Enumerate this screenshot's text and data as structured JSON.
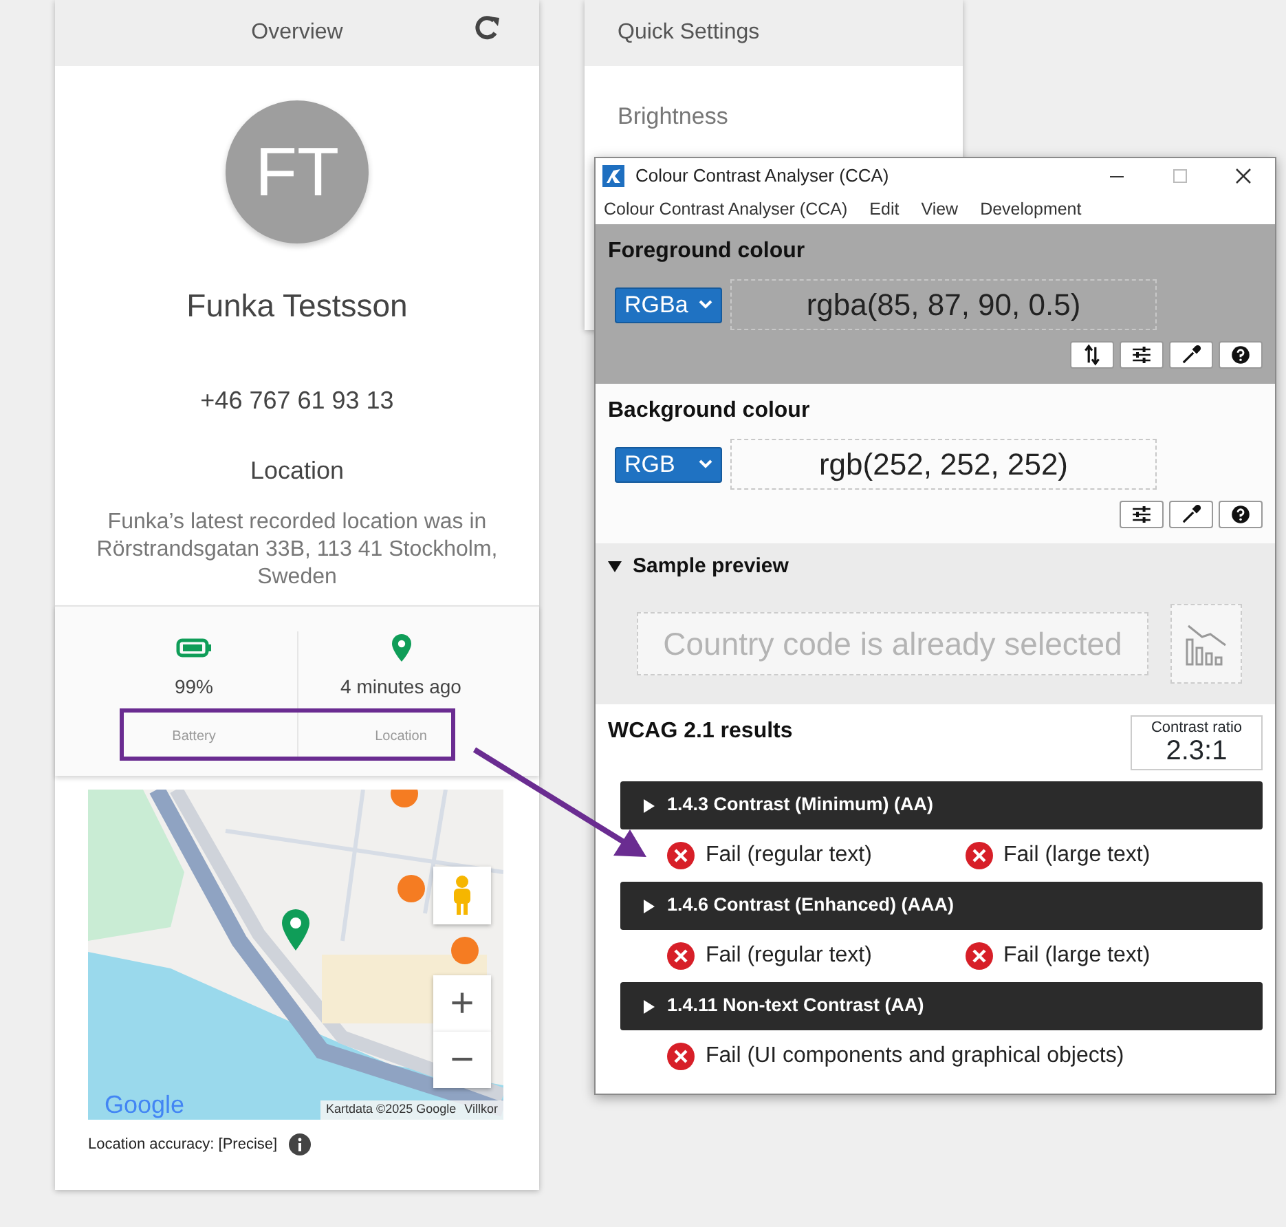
{
  "overview": {
    "title": "Overview",
    "initials": "FT",
    "name": "Funka Testsson",
    "phone": "+46 767 61 93 13",
    "location_heading": "Location",
    "location_text": "Funka’s latest recorded location was in Rörstrandsgatan 33B, 113 41 Stockholm, Sweden",
    "stats": [
      {
        "kind": "battery",
        "value": "99%",
        "label": "Battery"
      },
      {
        "kind": "location",
        "value": "4 minutes ago",
        "label": "Location"
      }
    ],
    "map": {
      "zoom_in": "+",
      "zoom_out": "−",
      "logo": "Google",
      "attribution": "Kartdata ©2025 Google",
      "terms": "Villkor"
    },
    "accuracy": "Location accuracy: [Precise]"
  },
  "quick_settings": {
    "title": "Quick Settings",
    "brightness": "Brightness"
  },
  "cca": {
    "title": "Colour Contrast Analyser (CCA)",
    "menu": [
      "Colour Contrast Analyser (CCA)",
      "Edit",
      "View",
      "Development"
    ],
    "colours": [
      {
        "kind": "foreground",
        "heading": "Foreground colour",
        "format": "RGBa",
        "value": "rgba(85, 87, 90, 0.5)"
      },
      {
        "kind": "background",
        "heading": "Background colour",
        "format": "RGB",
        "value": "rgb(252, 252, 252)"
      }
    ],
    "sample": {
      "heading": "Sample preview",
      "expanded": true,
      "text": "Country code is already selected"
    },
    "results": {
      "heading": "WCAG 2.1 results",
      "ratio_label": "Contrast ratio",
      "ratio": "2.3:1",
      "criteria": [
        {
          "title": "1.4.3 Contrast (Minimum) (AA)",
          "expanded": false,
          "results": [
            {
              "text": "Fail (regular text)",
              "pass": false
            },
            {
              "text": "Fail (large text)",
              "pass": false
            }
          ]
        },
        {
          "title": "1.4.6 Contrast (Enhanced) (AAA)",
          "expanded": false,
          "results": [
            {
              "text": "Fail (regular text)",
              "pass": false
            },
            {
              "text": "Fail (large text)",
              "pass": false
            }
          ]
        },
        {
          "title": "1.4.11 Non-text Contrast (AA)",
          "expanded": false,
          "results": [
            {
              "text": "Fail (UI components and graphical objects)",
              "pass": false
            }
          ]
        }
      ]
    }
  }
}
